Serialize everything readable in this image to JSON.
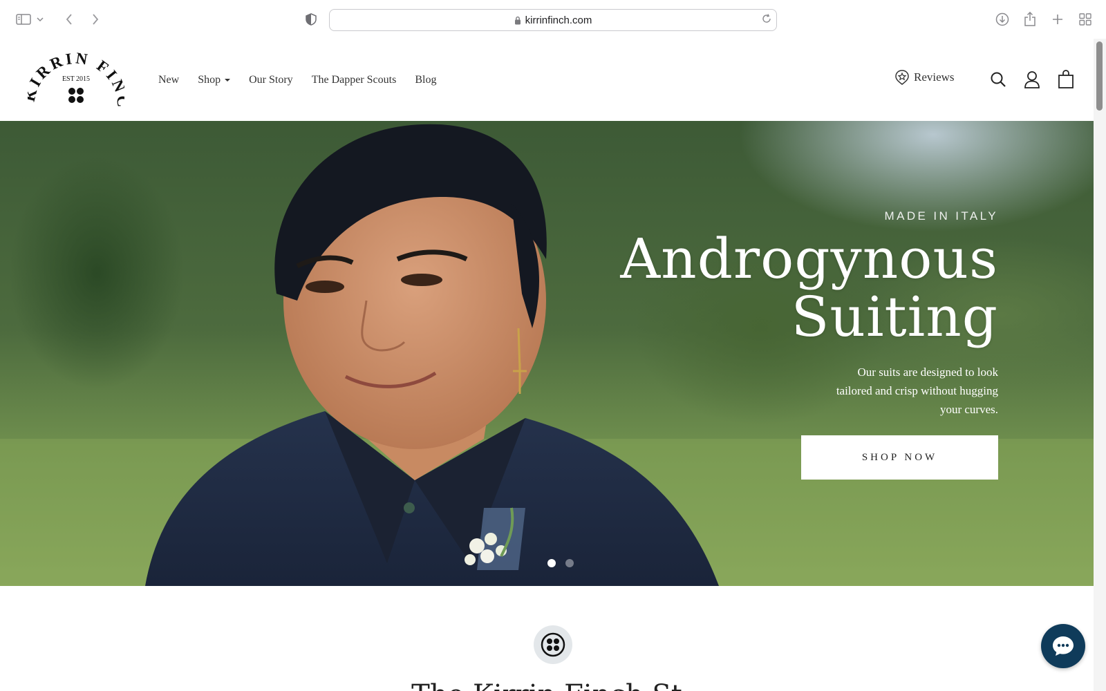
{
  "browser": {
    "url": "kirrinfinch.com"
  },
  "logo": {
    "brand": "KIRRIN FINCH",
    "established": "EST 2015"
  },
  "nav": {
    "items": [
      {
        "label": "New"
      },
      {
        "label": "Shop"
      },
      {
        "label": "Our Story"
      },
      {
        "label": "The Dapper Scouts"
      },
      {
        "label": "Blog"
      }
    ],
    "reviews_label": "Reviews"
  },
  "hero": {
    "eyebrow": "MADE IN ITALY",
    "headline_line1": "Androgynous",
    "headline_line2": "Suiting",
    "subcopy": "Our suits are designed to look tailored and crisp without hugging your curves.",
    "cta_label": "SHOP NOW",
    "slides_total": 2,
    "slide_active": 1
  },
  "section": {
    "title": "The Kirrin Finch St"
  },
  "colors": {
    "chat_button": "#0f3b5a",
    "badge_bg": "#e3e7ea"
  }
}
